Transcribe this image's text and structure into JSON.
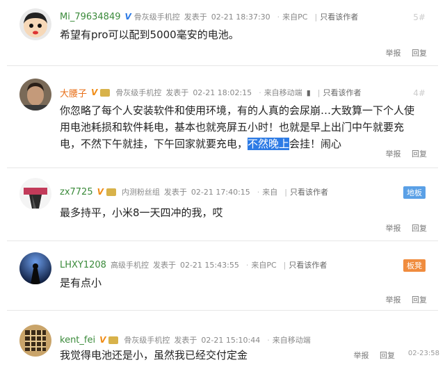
{
  "posts": [
    {
      "username": "Mi_79634849",
      "badge": "V",
      "level": "",
      "group": "骨灰级手机控",
      "posted_label": "发表于",
      "time": "02-21 18:37:30",
      "source": "来自PC",
      "only_author": "只看该作者",
      "floor": "5#",
      "content": "希望有pro可以配到5000毫安的电池。",
      "report": "举报",
      "reply": "回复"
    },
    {
      "username": "大腰子",
      "badge": "V",
      "group": "骨灰级手机控",
      "posted_label": "发表于",
      "time": "02-21 18:02:15",
      "source": "来自移动端",
      "only_author": "只看该作者",
      "floor": "4#",
      "content_before": "你忽略了每个人安装软件和使用环境，有的人真的会尿崩…大致算一下个人使用电池耗损和软件耗电，基本也就亮屏五小时！也就是早上出门中午就要充电，不然下午就挂，下午回家就要充电，",
      "content_highlight": "不然晚上",
      "content_after": "会挂！闹心",
      "report": "举报",
      "reply": "回复"
    },
    {
      "username": "zx7725",
      "badge": "V",
      "group": "内测粉丝组",
      "posted_label": "发表于",
      "time": "02-21 17:40:15",
      "source": "来自",
      "only_author": "只看该作者",
      "tag": "地板",
      "content": "最多持平，小米8一天四冲的我，哎",
      "report": "举报",
      "reply": "回复"
    },
    {
      "username": "LHXY1208",
      "group": "高级手机控",
      "posted_label": "发表于",
      "time": "02-21 15:43:55",
      "source": "来自PC",
      "only_author": "只看该作者",
      "tag": "板凳",
      "content": "是有点小",
      "report": "举报",
      "reply": "回复"
    },
    {
      "username": "kent_fei",
      "badge": "V",
      "group": "骨灰级手机控",
      "posted_label": "发表于",
      "time": "02-21 15:10:44",
      "source": "来自移动端",
      "floor": "02-23:58",
      "content": "我觉得电池还是小，虽然我已经交付定金",
      "report": "举报",
      "reply": "回复"
    }
  ],
  "colors": {
    "accent": "#2d7be5",
    "vip_name": "#e8701a",
    "normal_name": "#3a8a3a",
    "tag_blue": "#5aa0e6",
    "tag_orange": "#f08c3e"
  }
}
